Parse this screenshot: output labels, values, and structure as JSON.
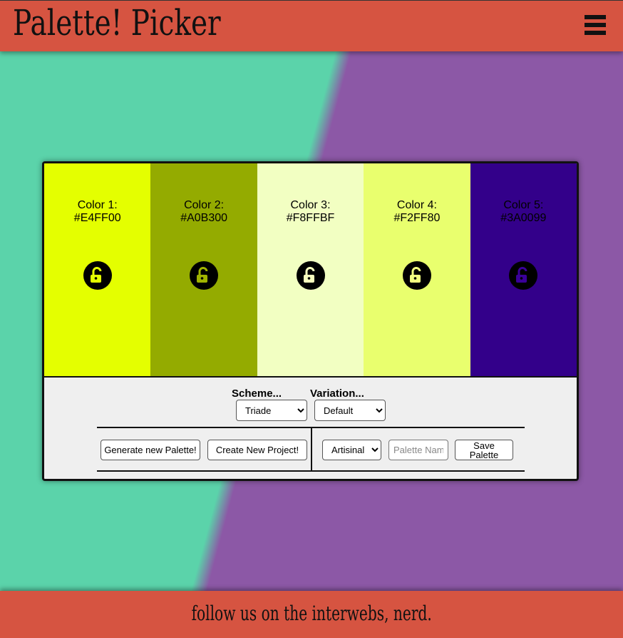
{
  "header": {
    "title": "Palette! Picker",
    "menu_icon": "hamburger-menu-icon"
  },
  "palette": {
    "colors": [
      {
        "label": "Color 1:",
        "hex": "#E4FF00",
        "lock_icon": "unlocked-padlock-icon"
      },
      {
        "label": "Color 2:",
        "hex": "#A0B300",
        "lock_icon": "unlocked-padlock-icon"
      },
      {
        "label": "Color 3:",
        "hex": "#F8FFBF",
        "lock_icon": "unlocked-padlock-icon"
      },
      {
        "label": "Color 4:",
        "hex": "#F2FF80",
        "lock_icon": "unlocked-padlock-icon"
      },
      {
        "label": "Color 5:",
        "hex": "#3A0099",
        "lock_icon": "unlocked-padlock-icon"
      }
    ]
  },
  "controls": {
    "scheme_label": "Scheme...",
    "scheme_value": "Triade",
    "variation_label": "Variation...",
    "variation_value": "Default",
    "generate_button": "Generate new Palette!",
    "create_project_button": "Create New Project!",
    "project_value": "Artisinal",
    "palette_name_placeholder": "Palette Name",
    "save_button": "Save Palette"
  },
  "footer": {
    "text": "follow us on the interwebs, nerd."
  },
  "colors": {
    "header_bg": "#d65441",
    "bg_left": "#5bd3aa",
    "bg_right": "#8c58a6",
    "panel_bg": "#efefef"
  }
}
